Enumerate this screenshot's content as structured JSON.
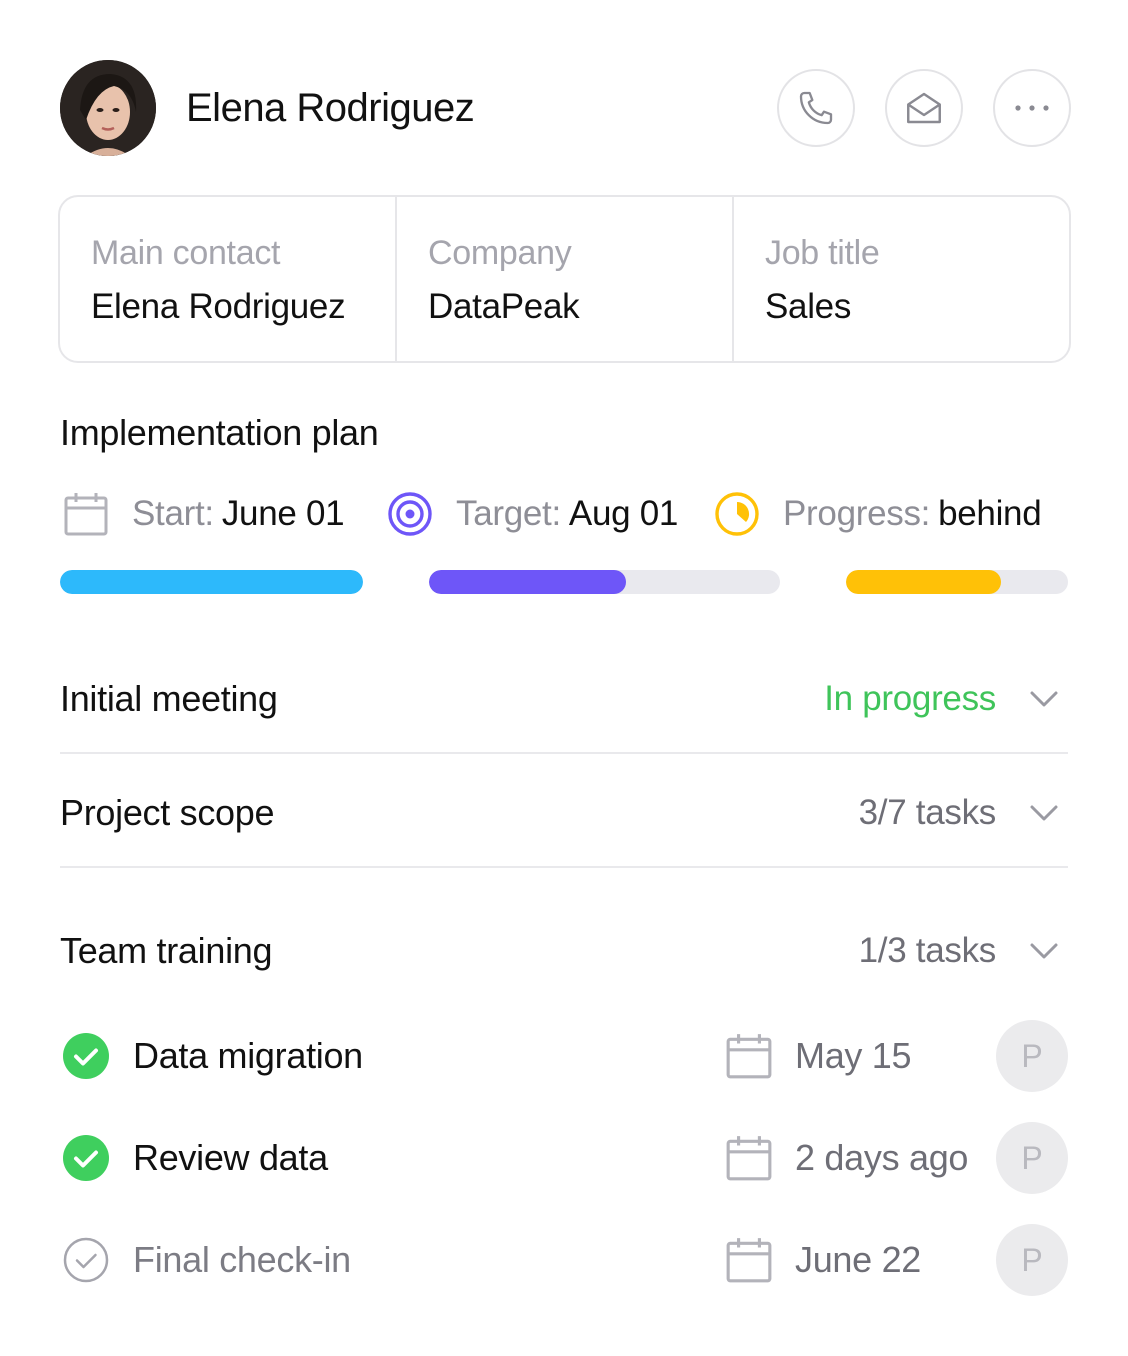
{
  "header": {
    "name": "Elena Rodriguez",
    "actions": [
      {
        "icon": "phone-icon"
      },
      {
        "icon": "mail-icon"
      },
      {
        "icon": "more-icon"
      }
    ]
  },
  "info": [
    {
      "label": "Main contact",
      "value": "Elena Rodriguez"
    },
    {
      "label": "Company",
      "value": "DataPeak"
    },
    {
      "label": "Job title",
      "value": "Sales"
    }
  ],
  "plan": {
    "title": "Implementation plan",
    "start": {
      "label": "Start:",
      "value": "June 01",
      "icon": "calendar-icon",
      "color": "#2db9fb",
      "progress": 1.0
    },
    "target": {
      "label": "Target:",
      "value": "Aug 01",
      "icon": "target-icon",
      "color": "#6e56f8",
      "progress": 0.56
    },
    "progress": {
      "label": "Progress:",
      "value": "behind",
      "icon": "progress-clock-icon",
      "color": "#ffc107",
      "progress": 0.7
    }
  },
  "stages": [
    {
      "title": "Initial meeting",
      "status": "In progress",
      "status_color": "#3fc45a"
    },
    {
      "title": "Project scope",
      "status": "3/7 tasks"
    },
    {
      "title": "Team training",
      "status": "1/3 tasks"
    }
  ],
  "tasks": [
    {
      "name": "Data migration",
      "date": "May 15",
      "done": true,
      "assignee": "P"
    },
    {
      "name": "Review data",
      "date": "2 days ago",
      "done": true,
      "assignee": "P"
    },
    {
      "name": "Final check-in",
      "date": "June 22",
      "done": false,
      "assignee": "P"
    }
  ],
  "colors": {
    "done_green": "#3fcf5e",
    "muted_gray": "#a5a5ad"
  }
}
